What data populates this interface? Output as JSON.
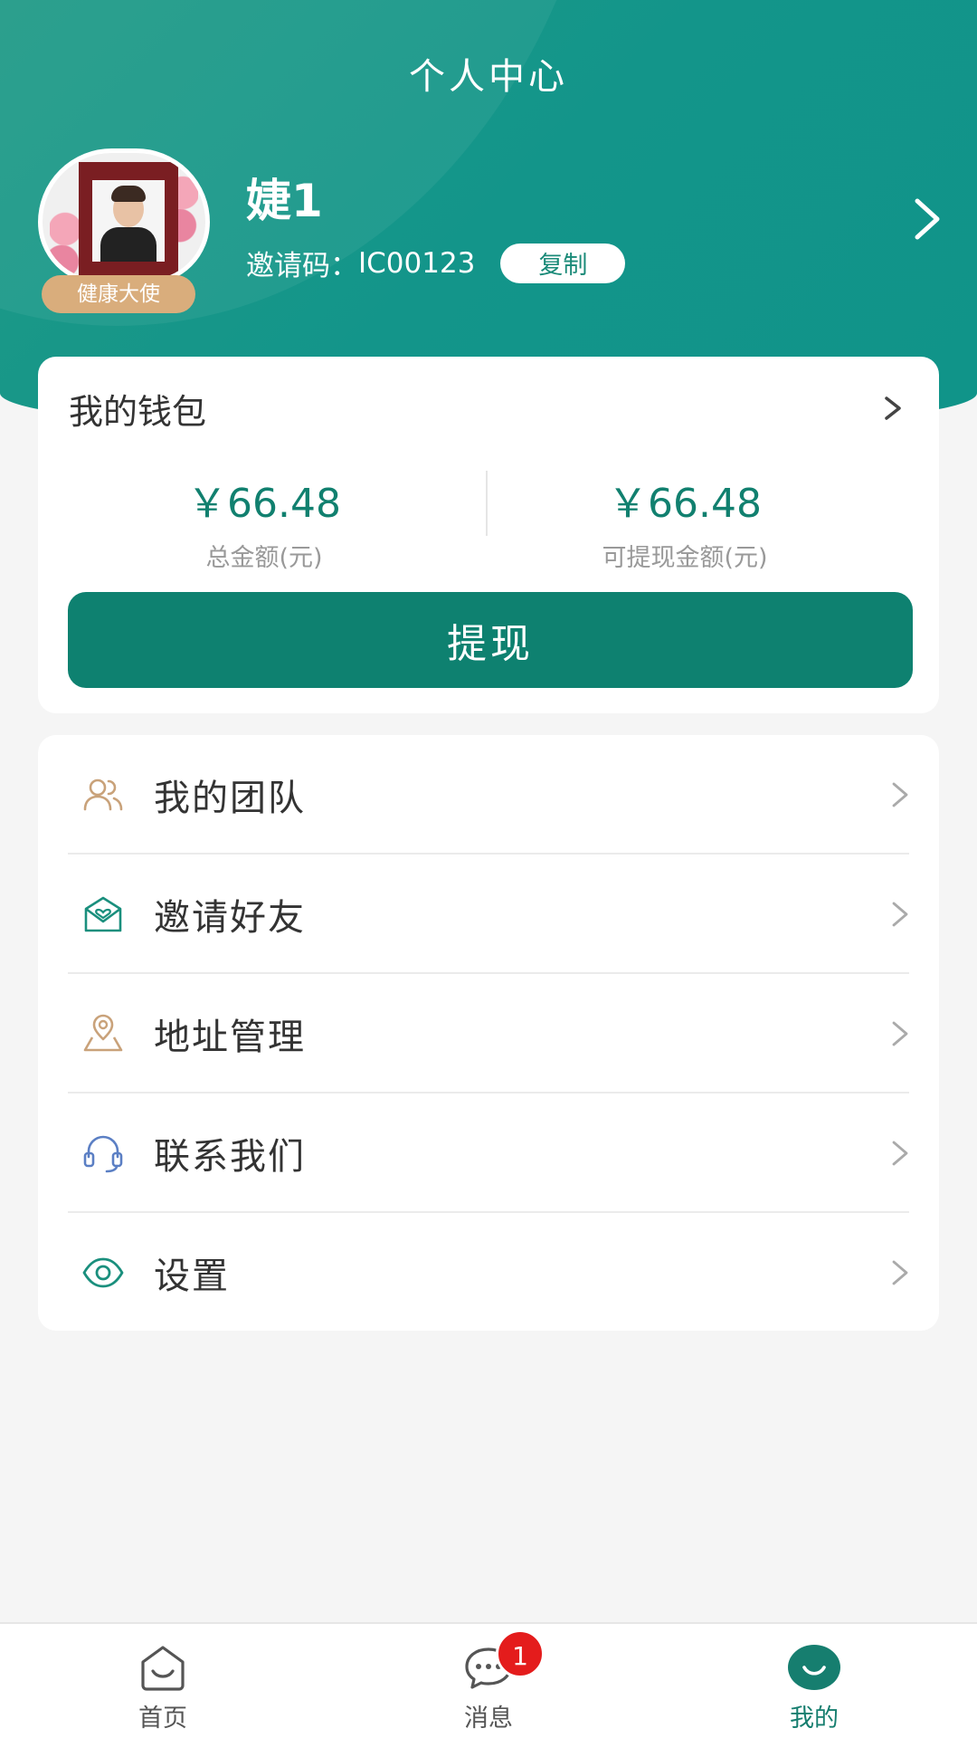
{
  "header": {
    "title": "个人中心",
    "user_name": "婕1",
    "role_badge": "健康大使",
    "invite_label": "邀请码：",
    "invite_code": "IC00123",
    "copy_label": "复制"
  },
  "wallet": {
    "title": "我的钱包",
    "total_amount": "￥66.48",
    "total_label": "总金额(元)",
    "withdrawable_amount": "￥66.48",
    "withdrawable_label": "可提现金额(元)",
    "withdraw_button": "提现"
  },
  "menu": {
    "items": [
      {
        "label": "我的团队",
        "icon": "team-icon"
      },
      {
        "label": "邀请好友",
        "icon": "invite-icon"
      },
      {
        "label": "地址管理",
        "icon": "location-icon"
      },
      {
        "label": "联系我们",
        "icon": "headset-icon"
      },
      {
        "label": "设置",
        "icon": "settings-eye-icon"
      }
    ]
  },
  "tabbar": {
    "tabs": [
      {
        "label": "首页",
        "icon": "home-smile-icon"
      },
      {
        "label": "消息",
        "icon": "chat-bubble-icon",
        "badge": "1"
      },
      {
        "label": "我的",
        "icon": "profile-smile-icon",
        "active": true
      }
    ]
  },
  "colors": {
    "primary": "#0e8170",
    "header_bg": "#13958a",
    "badge_gold": "#d9ad7c",
    "notification_red": "#e41c1c"
  }
}
